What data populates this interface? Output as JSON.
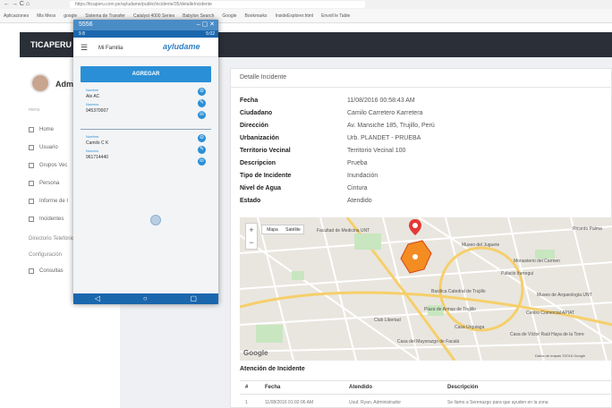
{
  "browser": {
    "nav": "← → C ⌂",
    "address": "https://ticaperu.com.pe/ayludame/public/incidente/35/detalleIncidente",
    "bookmarks": [
      "Aplicaciones",
      "Mis Mess",
      "google",
      "Sistema de Transfer",
      "Catalyst 4000 Series",
      "Babylon Search",
      "Google",
      "Bookmarks",
      "InsideExplorer.html",
      "Envoll le Table"
    ]
  },
  "app": {
    "brand": "TICAPERU",
    "user": "Admi",
    "menu_caption": "menu",
    "menu": [
      "Home",
      "Usuario",
      "Grupos Vec",
      "Persona",
      "Informe de I",
      "Incidentes"
    ],
    "sections": [
      "Directorio Telefónico",
      "Configuración"
    ],
    "menu_last": "Consultas"
  },
  "detail": {
    "title": "Detalle Incidente",
    "rows": [
      {
        "label": "Fecha",
        "value": "11/08/2016 00:58:43 AM"
      },
      {
        "label": "Ciudadano",
        "value": "Camilo Carretero Karretera"
      },
      {
        "label": "Dirección",
        "value": "Av. Mansiche 185, Trujillo, Perú"
      },
      {
        "label": "Urbanización",
        "value": "Urb. PLANDET - PRUEBA"
      },
      {
        "label": "Territorio Vecinal",
        "value": "Territorio Vecinal 100"
      },
      {
        "label": "Descripcion",
        "value": "Prueba"
      },
      {
        "label": "Tipo de Incidente",
        "value": "Inundación"
      },
      {
        "label": "Nivel de Agua",
        "value": "Cintura"
      },
      {
        "label": "Estado",
        "value": "Atendido"
      }
    ]
  },
  "map": {
    "zoom_in": "+",
    "zoom_out": "−",
    "types": [
      "Mapa",
      "Satélite"
    ],
    "labels": [
      "Facultad de Medicina UNT",
      "Museo del Juguete",
      "Monasterio del Carmen",
      "Palacio Iturregui",
      "Basílica Catedral de Trujillo",
      "Museo de Arqueología UNT",
      "Plaza de Armas de Trujillo",
      "Centro Comercial APIAT",
      "Casa de Víctor Raúl Haya de la Torre",
      "Casa del Mayorazgo de Facalá",
      "Club Libertad",
      "Casa Urquiaga",
      "Ricardo Palma"
    ],
    "logo": "Google",
    "footer": "Datos de mapas ©2016 Google"
  },
  "attention": {
    "title": "Atención de Incidente",
    "headers": [
      "#",
      "Fecha",
      "Atendido",
      "Descripción"
    ],
    "row": [
      "1",
      "11/08/2016 01:02:06 AM",
      "Usuf. Ryan, Administrador",
      "Se llamo a Serenazgo para que ayuden en la zona"
    ]
  },
  "phone": {
    "window_title": "5556",
    "status_left": "9 8",
    "status_right": "5:02",
    "menu": "☰",
    "app_title": "Mi Familia",
    "logo": "ayludame",
    "add_button": "AGREGAR",
    "entries": [
      {
        "k1": "Nombre",
        "v1": "Ale AC",
        "k2": "Numero",
        "v2": "945370007"
      },
      {
        "k1": "Nombre",
        "v1": "Camilo C K",
        "k2": "Numero",
        "v2": "961714440"
      }
    ]
  },
  "colors": {
    "header": "#2a2f38",
    "accent": "#2a8fd6",
    "map_marker": "#e53935"
  }
}
